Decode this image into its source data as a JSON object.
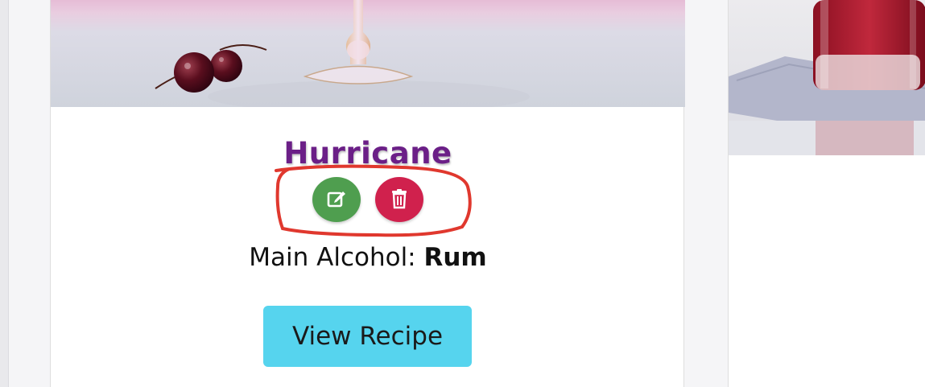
{
  "card": {
    "title": "Hurricane",
    "main_alcohol_label": "Main Alcohol: ",
    "main_alcohol_value": "Rum",
    "view_button_label": "View Recipe",
    "edit_icon": "edit-icon",
    "delete_icon": "trash-icon"
  },
  "colors": {
    "title": "#6b1f87",
    "edit_button": "#4f9e4f",
    "delete_button": "#d0214d",
    "view_button": "#56d4ee",
    "annotation": "#e0382e"
  }
}
